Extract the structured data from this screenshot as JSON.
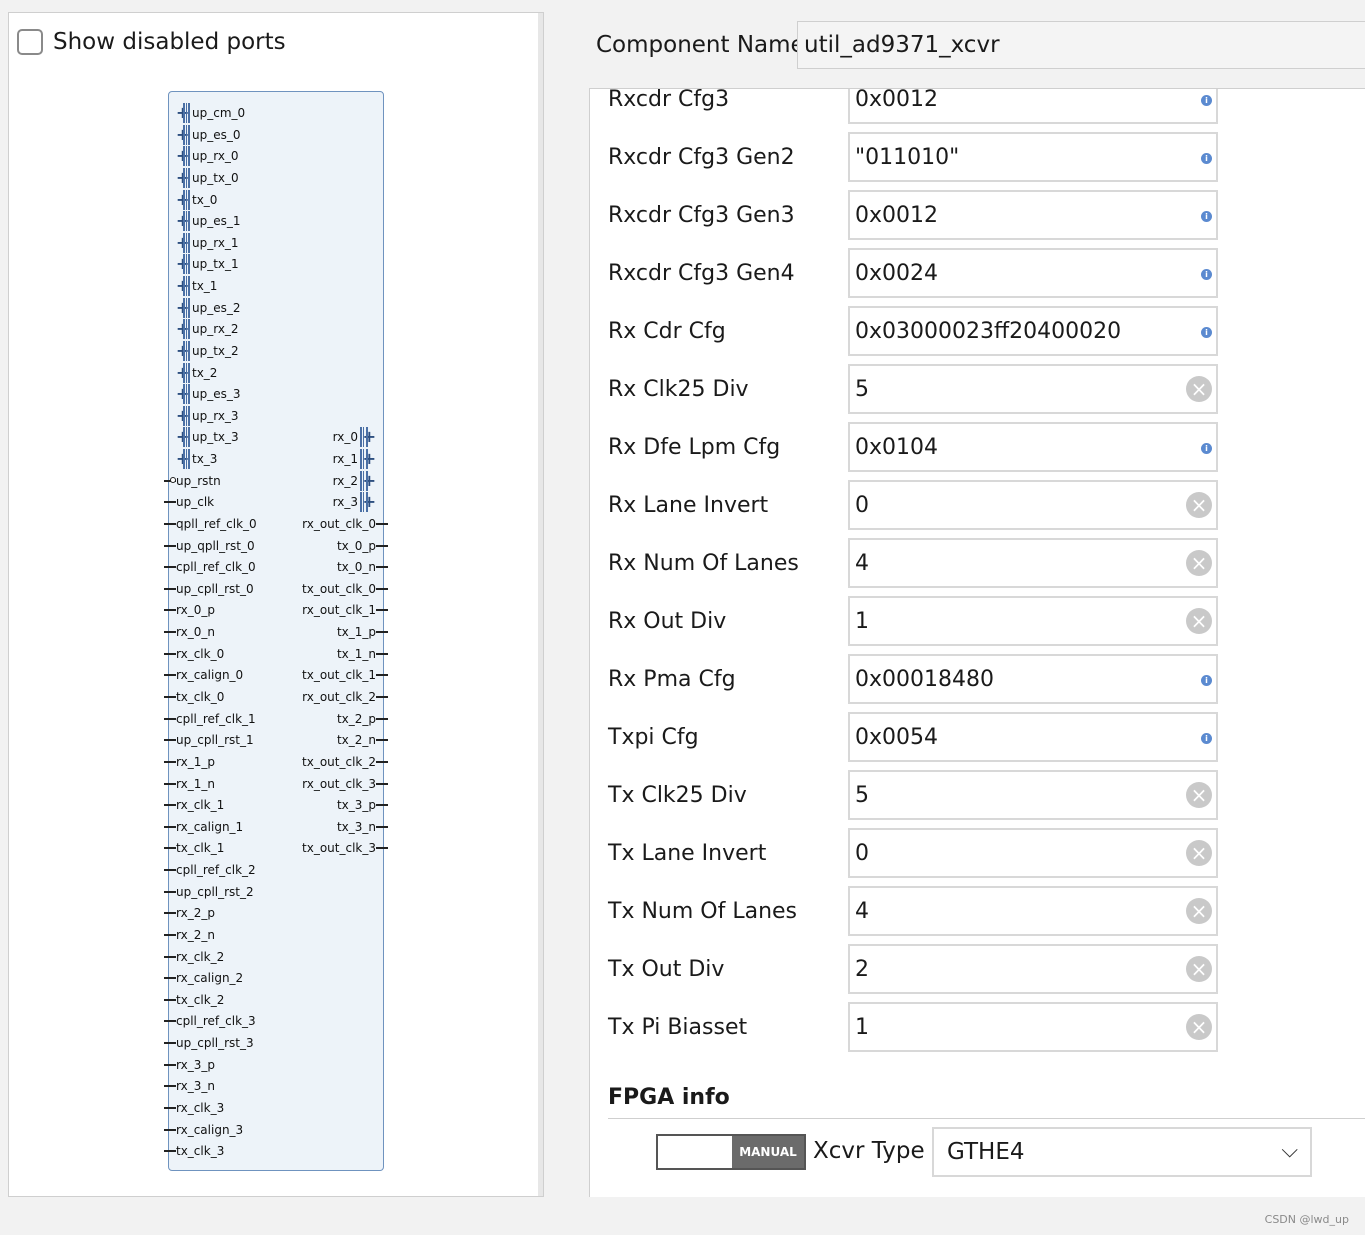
{
  "left_panel": {
    "show_disabled_label": "Show disabled ports",
    "left_bus_ports": [
      "up_cm_0",
      "up_es_0",
      "up_rx_0",
      "up_tx_0",
      "tx_0",
      "up_es_1",
      "up_rx_1",
      "up_tx_1",
      "tx_1",
      "up_es_2",
      "up_rx_2",
      "up_tx_2",
      "tx_2",
      "up_es_3",
      "up_rx_3",
      "up_tx_3",
      "tx_3"
    ],
    "left_ports": [
      "up_rstn",
      "up_clk",
      "qpll_ref_clk_0",
      "up_qpll_rst_0",
      "cpll_ref_clk_0",
      "up_cpll_rst_0",
      "rx_0_p",
      "rx_0_n",
      "rx_clk_0",
      "rx_calign_0",
      "tx_clk_0",
      "cpll_ref_clk_1",
      "up_cpll_rst_1",
      "rx_1_p",
      "rx_1_n",
      "rx_clk_1",
      "rx_calign_1",
      "tx_clk_1",
      "cpll_ref_clk_2",
      "up_cpll_rst_2",
      "rx_2_p",
      "rx_2_n",
      "rx_clk_2",
      "rx_calign_2",
      "tx_clk_2",
      "cpll_ref_clk_3",
      "up_cpll_rst_3",
      "rx_3_p",
      "rx_3_n",
      "rx_clk_3",
      "rx_calign_3",
      "tx_clk_3"
    ],
    "right_bus_ports": [
      "rx_0",
      "rx_1",
      "rx_2",
      "rx_3"
    ],
    "right_ports": [
      "rx_out_clk_0",
      "tx_0_p",
      "tx_0_n",
      "tx_out_clk_0",
      "rx_out_clk_1",
      "tx_1_p",
      "tx_1_n",
      "tx_out_clk_1",
      "rx_out_clk_2",
      "tx_2_p",
      "tx_2_n",
      "tx_out_clk_2",
      "rx_out_clk_3",
      "tx_3_p",
      "tx_3_n",
      "tx_out_clk_3"
    ]
  },
  "component": {
    "label": "Component Name",
    "value": "util_ad9371_xcvr"
  },
  "params": [
    {
      "label": "Rxcdr Cfg3",
      "value": "0x0012",
      "icon": "info-icon"
    },
    {
      "label": "Rxcdr Cfg3 Gen2",
      "value": "\"011010\"",
      "icon": "info-icon"
    },
    {
      "label": "Rxcdr Cfg3 Gen3",
      "value": "0x0012",
      "icon": "info-icon"
    },
    {
      "label": "Rxcdr Cfg3 Gen4",
      "value": "0x0024",
      "icon": "info-icon"
    },
    {
      "label": "Rx Cdr Cfg",
      "value": "0x03000023ff20400020",
      "icon": "info-icon"
    },
    {
      "label": "Rx Clk25 Div",
      "value": "5",
      "icon": "clear-icon"
    },
    {
      "label": "Rx Dfe Lpm Cfg",
      "value": "0x0104",
      "icon": "info-icon"
    },
    {
      "label": "Rx Lane Invert",
      "value": "0",
      "icon": "clear-icon"
    },
    {
      "label": "Rx Num Of Lanes",
      "value": "4",
      "icon": "clear-icon"
    },
    {
      "label": "Rx Out Div",
      "value": "1",
      "icon": "clear-icon"
    },
    {
      "label": "Rx Pma Cfg",
      "value": "0x00018480",
      "icon": "info-icon"
    },
    {
      "label": "Txpi Cfg",
      "value": "0x0054",
      "icon": "info-icon"
    },
    {
      "label": "Tx Clk25 Div",
      "value": "5",
      "icon": "clear-icon"
    },
    {
      "label": "Tx Lane Invert",
      "value": "0",
      "icon": "clear-icon"
    },
    {
      "label": "Tx Num Of Lanes",
      "value": "4",
      "icon": "clear-icon"
    },
    {
      "label": "Tx Out Div",
      "value": "2",
      "icon": "clear-icon"
    },
    {
      "label": "Tx Pi Biasset",
      "value": "1",
      "icon": "clear-icon"
    }
  ],
  "fpga": {
    "title": "FPGA info",
    "manual_label": "MANUAL",
    "xcvr_label": "Xcvr Type",
    "xcvr_value": "GTHE4"
  },
  "watermark": "CSDN @lwd_up",
  "colors": {
    "block_fill": "#edf3f9",
    "block_border": "#6f93bf",
    "info_icon": "#5b8ad0"
  }
}
